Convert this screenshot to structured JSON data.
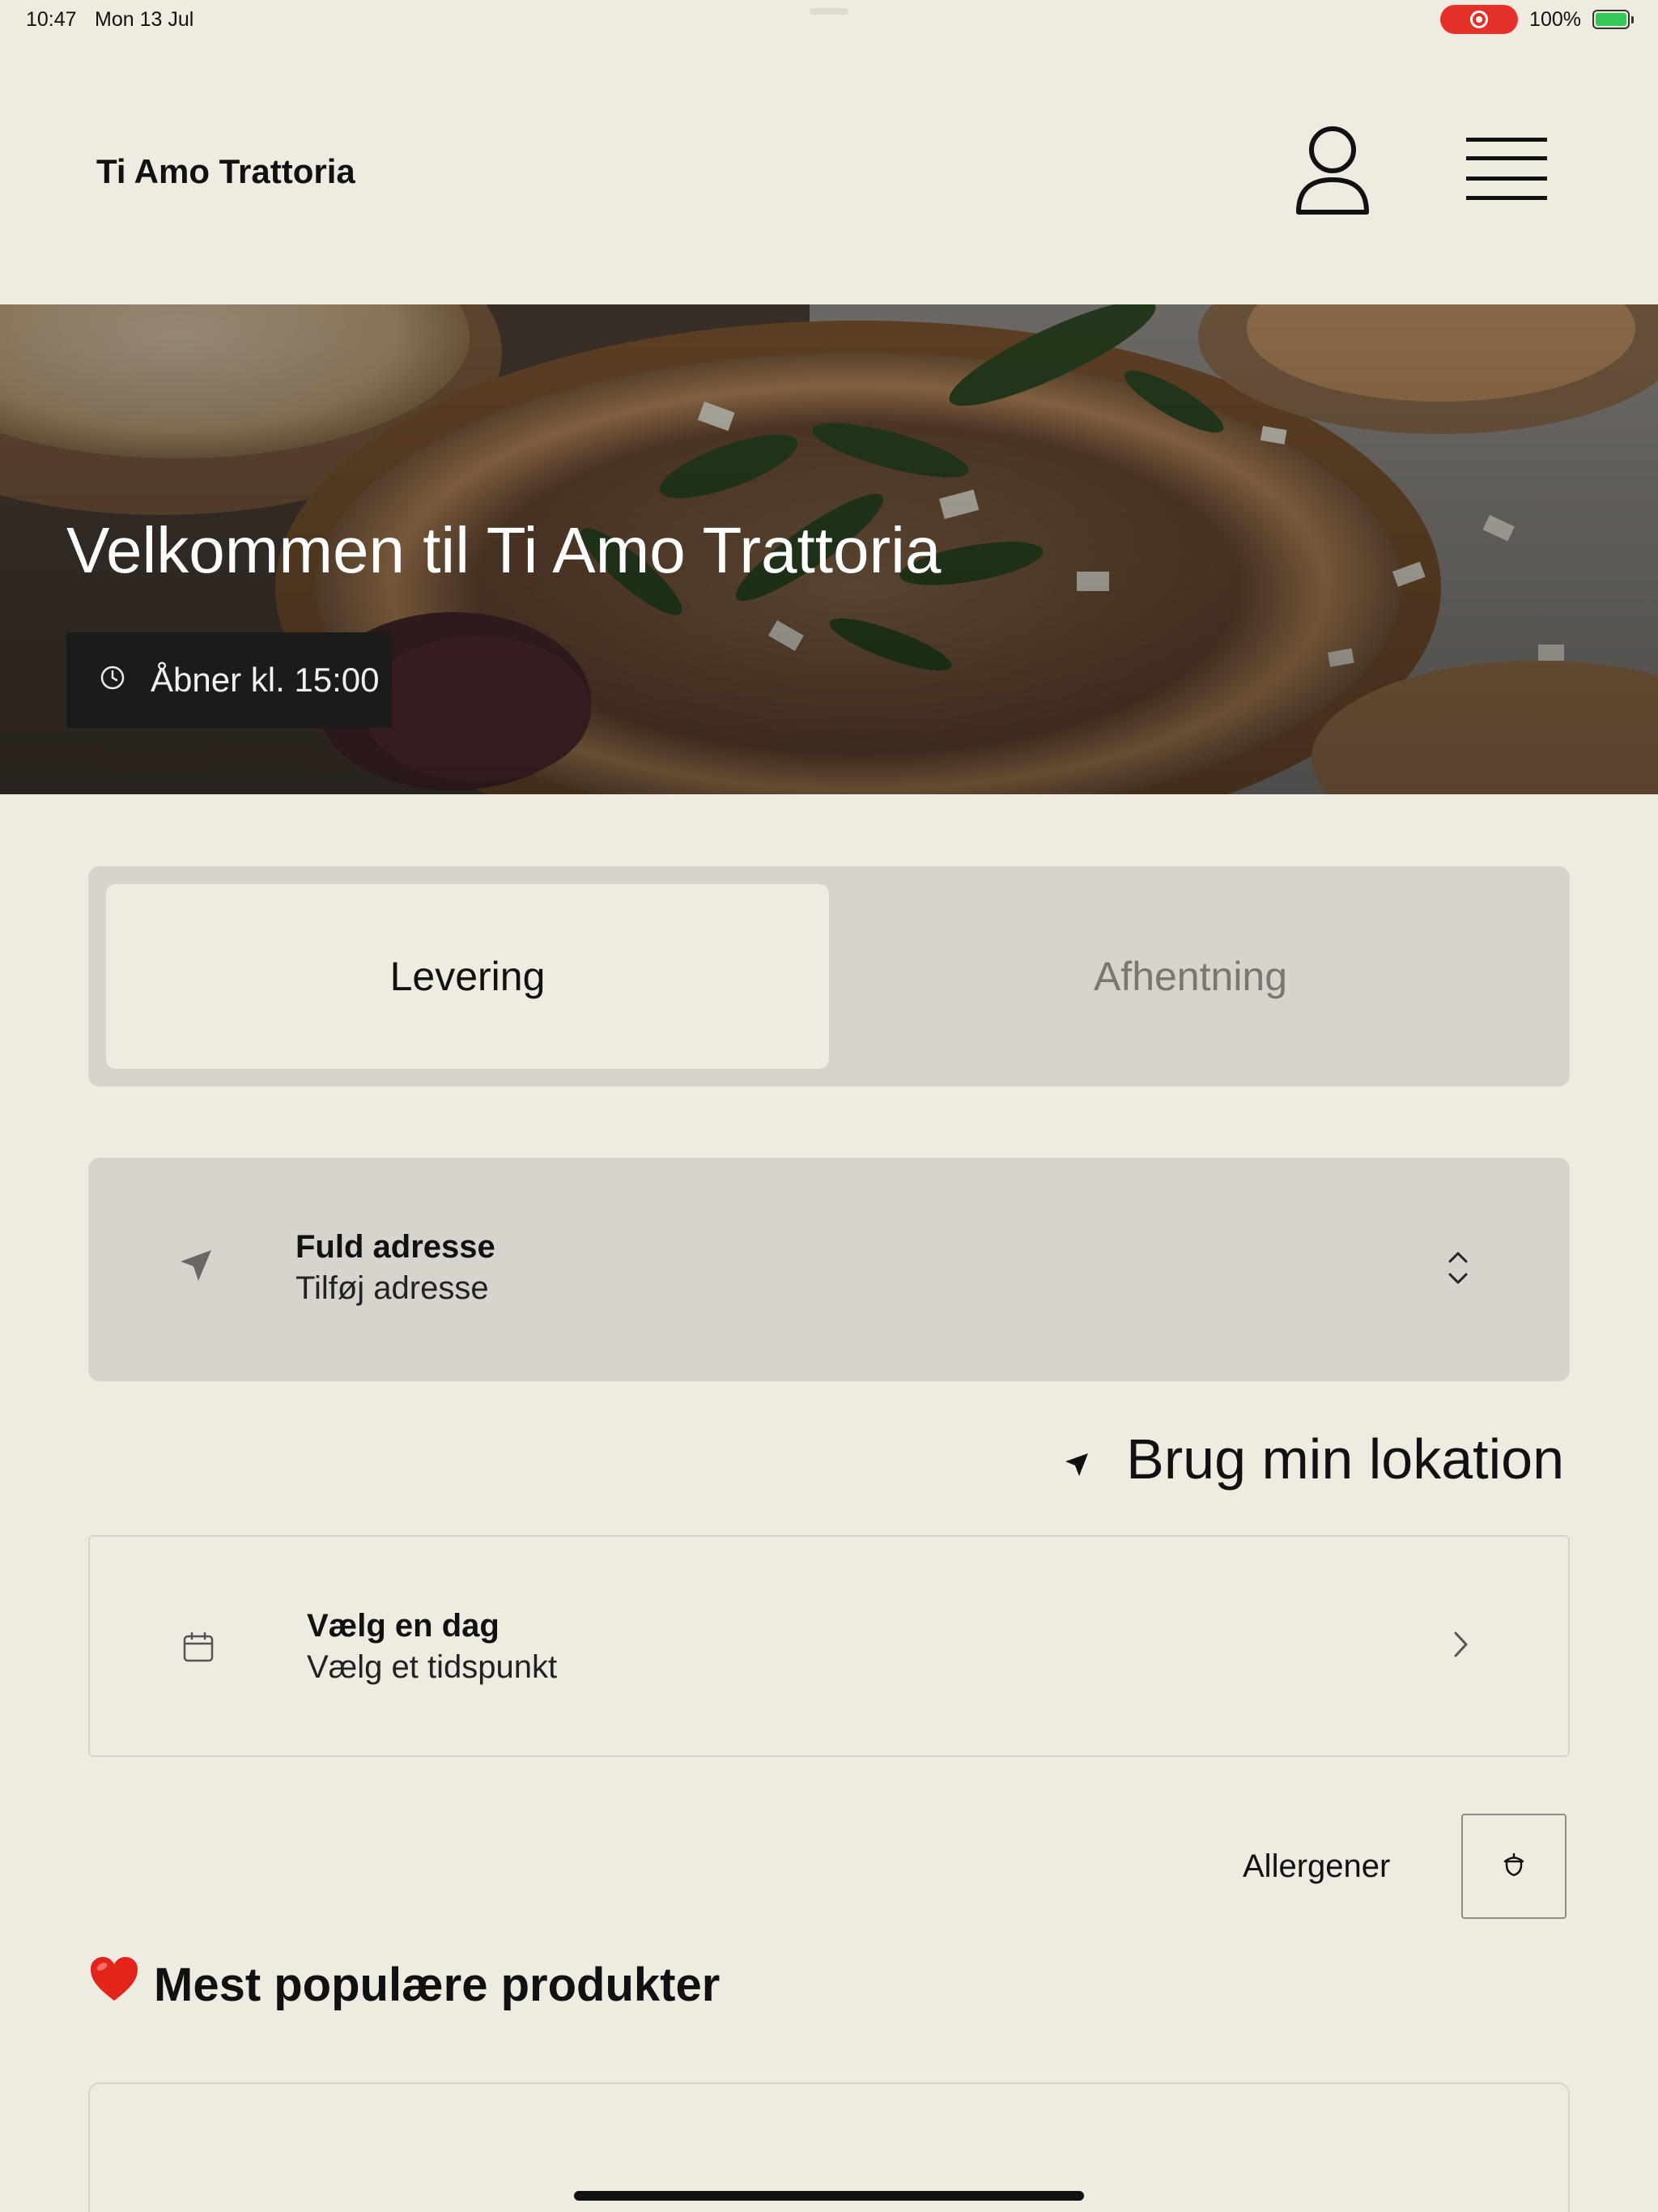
{
  "status_bar": {
    "time": "10:47",
    "date": "Mon 13 Jul",
    "battery": "100%"
  },
  "header": {
    "brand": "Ti Amo Trattoria",
    "user_icon": "user-icon",
    "menu_icon": "hamburger-menu-icon"
  },
  "hero": {
    "title": "Velkommen til Ti Amo Trattoria",
    "hours": "Åbner kl. 15:00",
    "hours_icon": "clock-icon"
  },
  "order_mode": {
    "tabs": [
      {
        "label": "Levering",
        "active": true
      },
      {
        "label": "Afhentning",
        "active": false
      }
    ]
  },
  "address": {
    "title": "Fuld adresse",
    "subtitle": "Tilføj adresse",
    "icon": "location-arrow-icon"
  },
  "location": {
    "label": "Brug min lokation"
  },
  "schedule": {
    "title": "Vælg en dag",
    "subtitle": "Vælg et tidspunkt",
    "icon": "calendar-icon"
  },
  "allergen": {
    "label": "Allergener",
    "icon": "acorn-icon"
  },
  "popular": {
    "emoji": "❤️",
    "title": "Mest populære produkter"
  },
  "colors": {
    "background": "#f0ebe1",
    "panel": "#d8d4cd",
    "dark_badge": "#1d1b19",
    "record": "#e5302a"
  }
}
